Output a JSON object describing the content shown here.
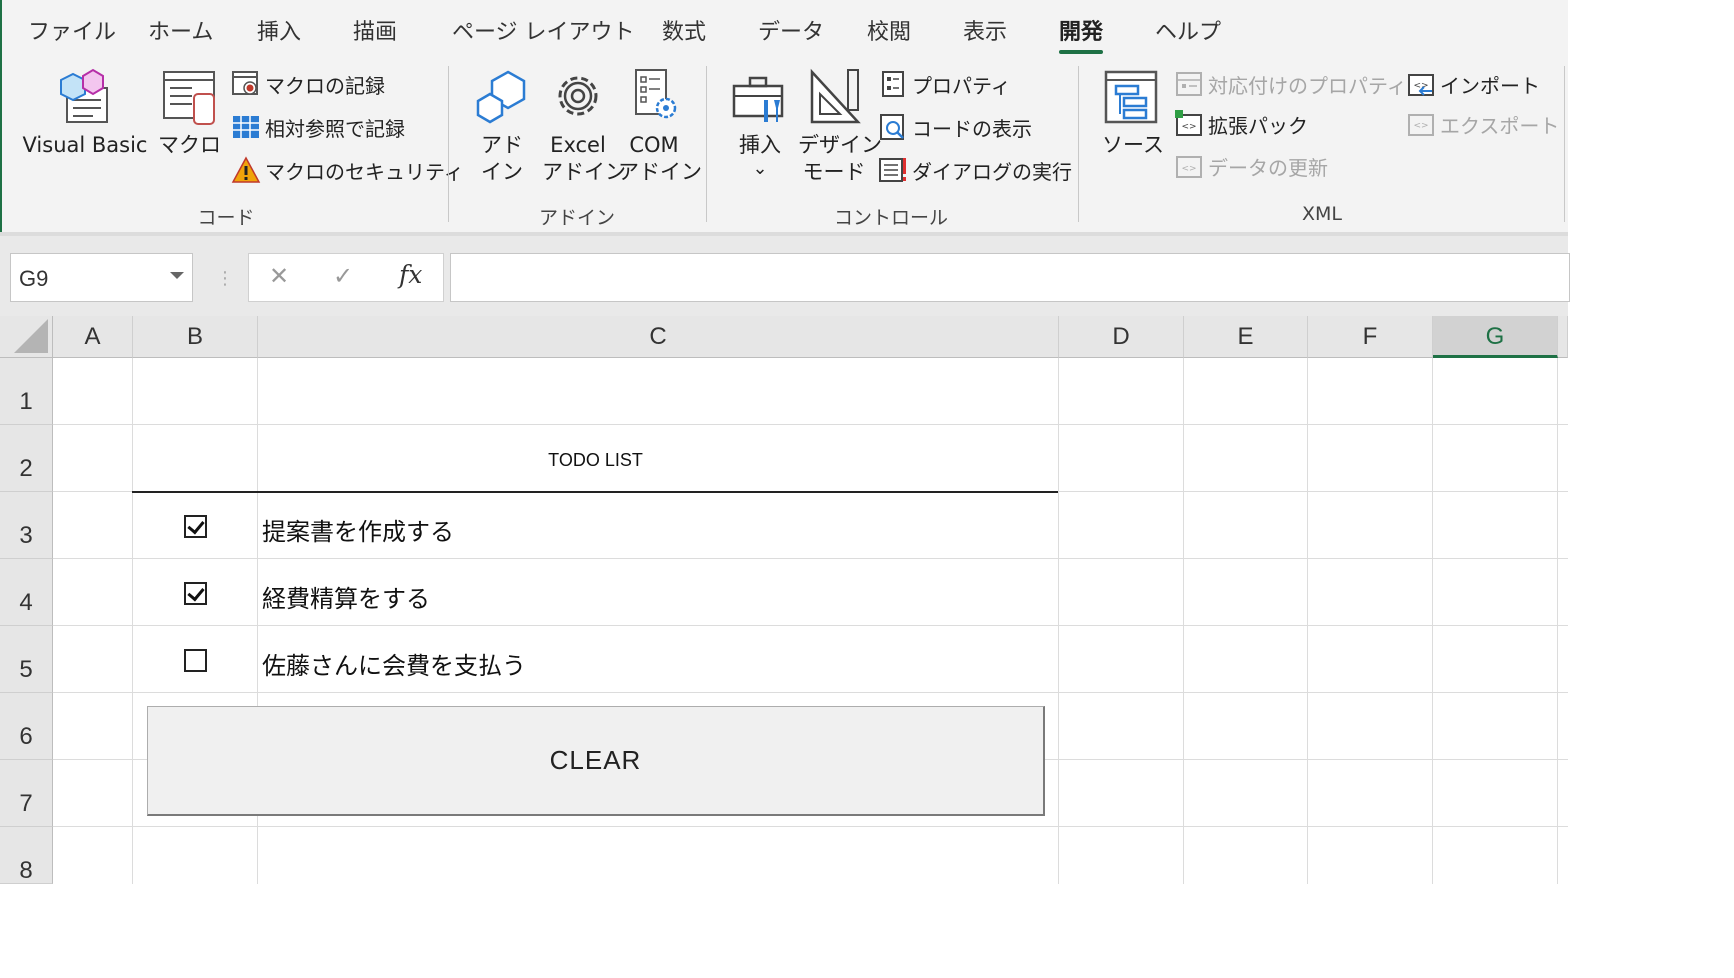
{
  "ribbon": {
    "tabs": [
      {
        "label": "ファイル",
        "active": false
      },
      {
        "label": "ホーム",
        "active": false
      },
      {
        "label": "挿入",
        "active": false
      },
      {
        "label": "描画",
        "active": false
      },
      {
        "label": "ページ レイアウト",
        "active": false
      },
      {
        "label": "数式",
        "active": false
      },
      {
        "label": "データ",
        "active": false
      },
      {
        "label": "校閲",
        "active": false
      },
      {
        "label": "表示",
        "active": false
      },
      {
        "label": "開発",
        "active": true
      },
      {
        "label": "ヘルプ",
        "active": false
      }
    ],
    "groups": {
      "code": {
        "label": "コード",
        "visual_basic": "Visual Basic",
        "macro": "マクロ",
        "record_macro": "マクロの記録",
        "relative_ref": "相対参照で記録",
        "macro_security": "マクロのセキュリティ"
      },
      "addins": {
        "label": "アドイン",
        "addin_line1": "アド",
        "addin_line2": "イン",
        "excel_addin_line1": "Excel",
        "excel_addin_line2": "アドイン",
        "com_addin_line1": "COM",
        "com_addin_line2": "アドイン"
      },
      "controls": {
        "label": "コントロール",
        "insert": "挿入",
        "insert_arrow": "⌄",
        "design_mode_line1": "デザイン",
        "design_mode_line2": "モード",
        "properties": "プロパティ",
        "view_code": "コードの表示",
        "run_dialog": "ダイアログの実行"
      },
      "xml": {
        "label": "XML",
        "source": "ソース",
        "map_properties": "対応付けのプロパティ",
        "expansion_packs": "拡張パック",
        "refresh_data": "データの更新",
        "import": "インポート",
        "export": "エクスポート"
      }
    }
  },
  "formula_bar": {
    "name_box": "G9",
    "cancel_glyph": "✕",
    "enter_glyph": "✓",
    "fx_glyph": "fx",
    "formula": ""
  },
  "grid": {
    "columns": [
      "A",
      "B",
      "C",
      "D",
      "E",
      "F",
      "G"
    ],
    "selected_column": "G",
    "rows": [
      "1",
      "2",
      "3",
      "4",
      "5",
      "6",
      "7",
      "8"
    ]
  },
  "sheet": {
    "title": "TODO LIST",
    "tasks": [
      {
        "text": "提案書を作成する",
        "checked": true
      },
      {
        "text": "経費精算をする",
        "checked": true
      },
      {
        "text": "佐藤さんに会費を支払う",
        "checked": false
      }
    ],
    "clear_button": "CLEAR"
  },
  "colors": {
    "accent": "#1e7145",
    "ribbon_bg": "#f3f3f3",
    "icon_blue": "#2b7cd3",
    "warning": "#f0a30a"
  }
}
